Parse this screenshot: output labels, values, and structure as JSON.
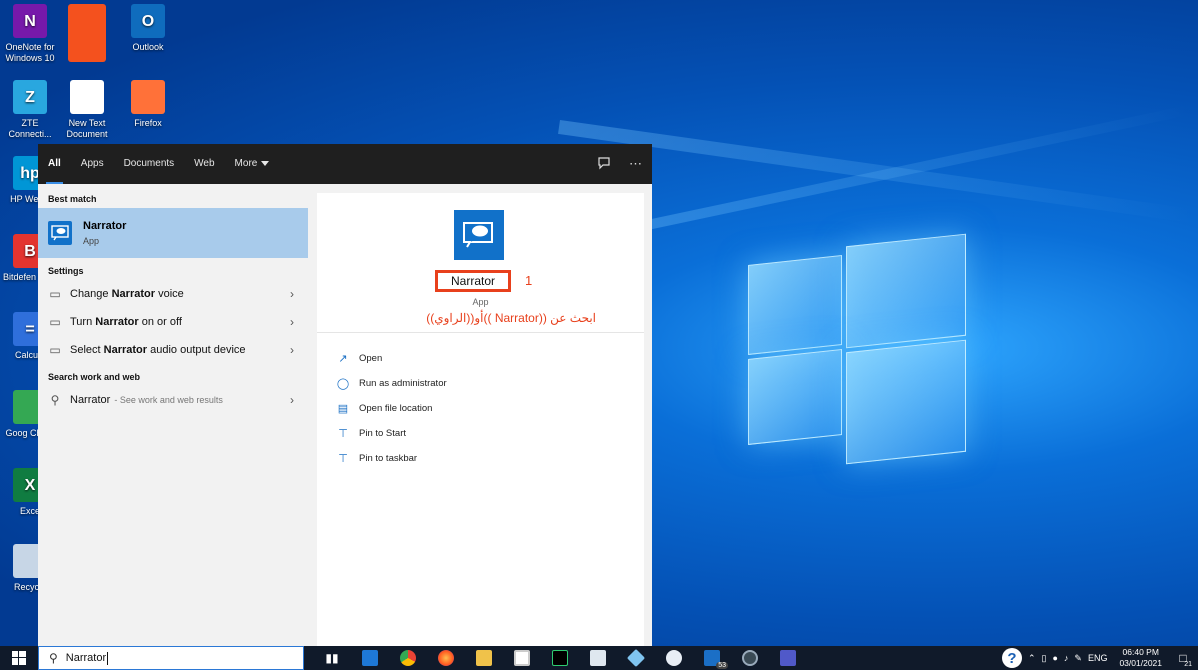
{
  "desktop": {
    "icons": [
      {
        "label": "OneNote for Windows 10",
        "icon": "onenote-icon",
        "color": "#7719aa",
        "glyph": "N"
      },
      {
        "label": "",
        "icon": "orange-tile-icon",
        "color": "#f4511e",
        "glyph": ""
      },
      {
        "label": "Outlook",
        "icon": "outlook-icon",
        "color": "#0f6cbd",
        "glyph": "O"
      },
      {
        "label": "ZTE Connecti...",
        "icon": "zte-icon",
        "color": "#29a7df",
        "glyph": "Z"
      },
      {
        "label": "New Text Document",
        "icon": "text-document-icon",
        "color": "#ffffff",
        "glyph": ""
      },
      {
        "label": "Firefox",
        "icon": "firefox-icon",
        "color": "#ff7139",
        "glyph": ""
      },
      {
        "label": "HP Welco",
        "icon": "hp-icon",
        "color": "#0096d6",
        "glyph": "hp"
      },
      {
        "label": "Bitdefen VPN",
        "icon": "bitdefender-vpn-icon",
        "color": "#e3342f",
        "glyph": "B"
      },
      {
        "label": "Calcula",
        "icon": "calculator-icon",
        "color": "#2f6fdb",
        "glyph": "="
      },
      {
        "label": "Goog Chron",
        "icon": "chrome-icon",
        "color": "#34a853",
        "glyph": ""
      },
      {
        "label": "Exce",
        "icon": "excel-icon",
        "color": "#107c41",
        "glyph": "X"
      },
      {
        "label": "Recycle",
        "icon": "recycle-bin-icon",
        "color": "#c7d6e6",
        "glyph": ""
      }
    ]
  },
  "search_panel": {
    "tabs": [
      {
        "label": "All",
        "active": true
      },
      {
        "label": "Apps",
        "active": false
      },
      {
        "label": "Documents",
        "active": false
      },
      {
        "label": "Web",
        "active": false
      },
      {
        "label": "More",
        "active": false
      }
    ],
    "best_match_title": "Best match",
    "best_match": {
      "name": "Narrator",
      "type": "App"
    },
    "settings_title": "Settings",
    "settings": [
      {
        "pre": "Change ",
        "bold": "Narrator",
        "post": " voice"
      },
      {
        "pre": "Turn ",
        "bold": "Narrator",
        "post": " on or off"
      },
      {
        "pre": "Select ",
        "bold": "Narrator",
        "post": " audio output device"
      }
    ],
    "web_title": "Search work and web",
    "web_result": {
      "query": "Narrator",
      "hint": "- See work and web results"
    },
    "detail": {
      "name": "Narrator",
      "annotation_number": "1",
      "type": "App",
      "note": "ابحث عن ((Narrator ))أو((الراوي))",
      "actions": [
        {
          "label": "Open",
          "icon": "open-icon"
        },
        {
          "label": "Run as administrator",
          "icon": "shield-icon"
        },
        {
          "label": "Open file location",
          "icon": "file-location-icon"
        },
        {
          "label": "Pin to Start",
          "icon": "pin-icon"
        },
        {
          "label": "Pin to taskbar",
          "icon": "pin-icon"
        }
      ]
    }
  },
  "taskbar": {
    "search_value": "Narrator",
    "mail_badge": "53",
    "tray": {
      "language": "ENG",
      "time": "06:40 PM",
      "date": "03/01/2021",
      "notification_count": "21"
    }
  },
  "colors": {
    "accent": "#1171c9",
    "annotation": "#e8401c",
    "best_match_bg": "#a8cbeb"
  }
}
